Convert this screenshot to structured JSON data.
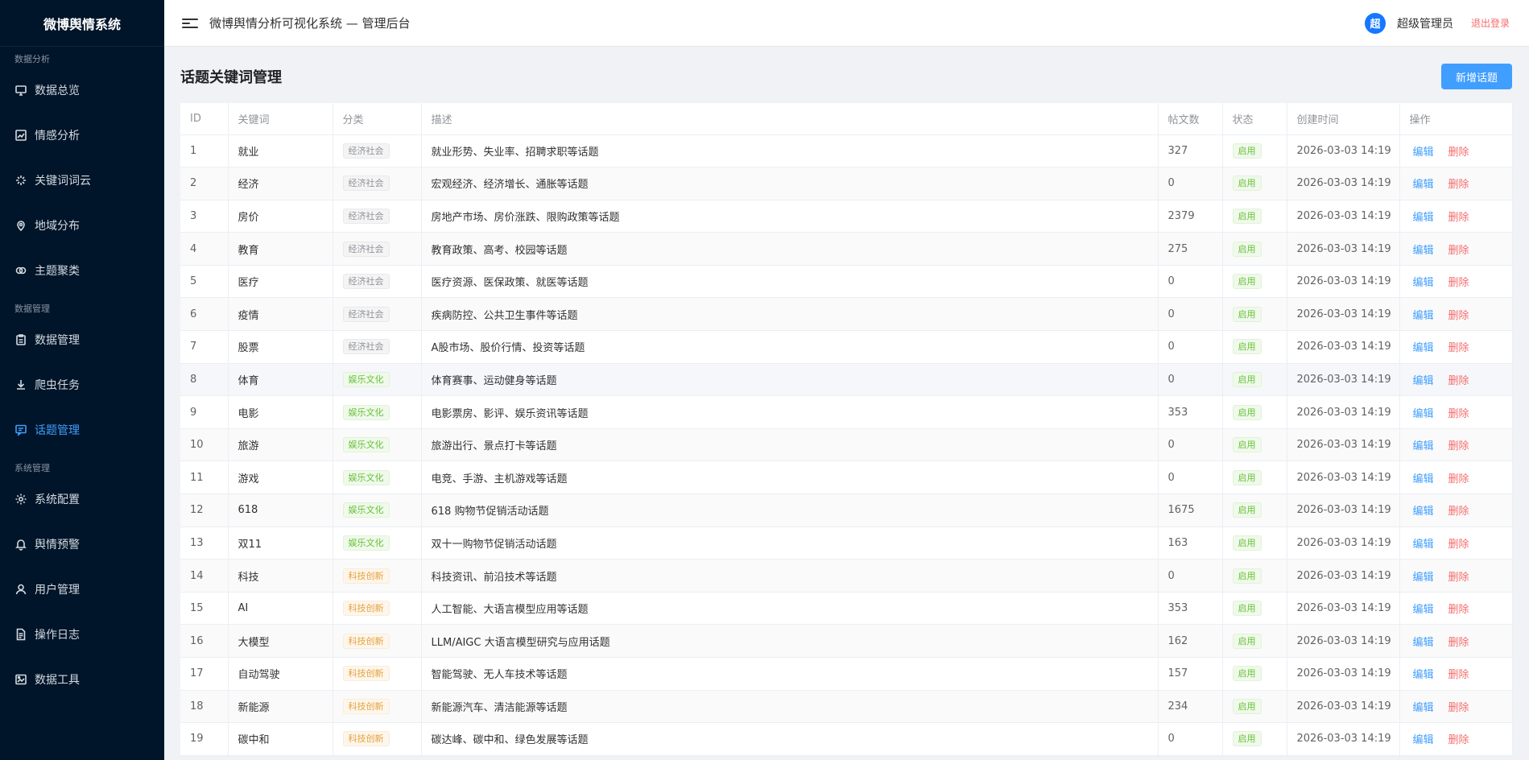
{
  "sidebar": {
    "logo": "微博舆情系统",
    "groups": [
      {
        "title": "数据分析",
        "items": [
          {
            "label": "数据总览",
            "icon": "monitor-icon"
          },
          {
            "label": "情感分析",
            "icon": "line-chart-icon"
          },
          {
            "label": "关键词词云",
            "icon": "sparkle-icon"
          },
          {
            "label": "地域分布",
            "icon": "location-pin-icon"
          },
          {
            "label": "主题聚类",
            "icon": "link-circles-icon"
          }
        ]
      },
      {
        "title": "数据管理",
        "items": [
          {
            "label": "数据管理",
            "icon": "clipboard-icon"
          },
          {
            "label": "爬虫任务",
            "icon": "download-icon"
          },
          {
            "label": "话题管理",
            "icon": "chat-icon",
            "active": true
          }
        ]
      },
      {
        "title": "系统管理",
        "items": [
          {
            "label": "系统配置",
            "icon": "gear-icon"
          },
          {
            "label": "舆情预警",
            "icon": "bell-icon"
          },
          {
            "label": "用户管理",
            "icon": "user-icon"
          },
          {
            "label": "操作日志",
            "icon": "document-icon"
          },
          {
            "label": "数据工具",
            "icon": "image-box-icon"
          }
        ]
      }
    ]
  },
  "header": {
    "title": "微博舆情分析可视化系统 — 管理后台",
    "avatar_text": "超",
    "username": "超级管理员",
    "logout": "退出登录"
  },
  "page": {
    "title": "话题关键词管理",
    "add_button": "新增话题"
  },
  "colors": {
    "accent": "#409eff",
    "danger": "#f56c6c",
    "sidebar_bg": "#001529"
  },
  "table": {
    "columns": [
      "ID",
      "关键词",
      "分类",
      "描述",
      "帖文数",
      "状态",
      "创建时间",
      "操作"
    ],
    "edit_label": "编辑",
    "delete_label": "删除",
    "rows": [
      {
        "id": "1",
        "keyword": "就业",
        "category": "经济社会",
        "cat": "gray",
        "desc": "就业形势、失业率、招聘求职等话题",
        "posts": "327",
        "status": "启用",
        "created": "2026-03-03 14:19"
      },
      {
        "id": "2",
        "keyword": "经济",
        "category": "经济社会",
        "cat": "gray",
        "desc": "宏观经济、经济增长、通胀等话题",
        "posts": "0",
        "status": "启用",
        "created": "2026-03-03 14:19"
      },
      {
        "id": "3",
        "keyword": "房价",
        "category": "经济社会",
        "cat": "gray",
        "desc": "房地产市场、房价涨跌、限购政策等话题",
        "posts": "2379",
        "status": "启用",
        "created": "2026-03-03 14:19"
      },
      {
        "id": "4",
        "keyword": "教育",
        "category": "经济社会",
        "cat": "gray",
        "desc": "教育政策、高考、校园等话题",
        "posts": "275",
        "status": "启用",
        "created": "2026-03-03 14:19"
      },
      {
        "id": "5",
        "keyword": "医疗",
        "category": "经济社会",
        "cat": "gray",
        "desc": "医疗资源、医保政策、就医等话题",
        "posts": "0",
        "status": "启用",
        "created": "2026-03-03 14:19"
      },
      {
        "id": "6",
        "keyword": "疫情",
        "category": "经济社会",
        "cat": "gray",
        "desc": "疾病防控、公共卫生事件等话题",
        "posts": "0",
        "status": "启用",
        "created": "2026-03-03 14:19"
      },
      {
        "id": "7",
        "keyword": "股票",
        "category": "经济社会",
        "cat": "gray",
        "desc": "A股市场、股价行情、投资等话题",
        "posts": "0",
        "status": "启用",
        "created": "2026-03-03 14:19"
      },
      {
        "id": "8",
        "keyword": "体育",
        "category": "娱乐文化",
        "cat": "green",
        "desc": "体育赛事、运动健身等话题",
        "posts": "0",
        "status": "启用",
        "created": "2026-03-03 14:19"
      },
      {
        "id": "9",
        "keyword": "电影",
        "category": "娱乐文化",
        "cat": "green",
        "desc": "电影票房、影评、娱乐资讯等话题",
        "posts": "353",
        "status": "启用",
        "created": "2026-03-03 14:19"
      },
      {
        "id": "10",
        "keyword": "旅游",
        "category": "娱乐文化",
        "cat": "green",
        "desc": "旅游出行、景点打卡等话题",
        "posts": "0",
        "status": "启用",
        "created": "2026-03-03 14:19"
      },
      {
        "id": "11",
        "keyword": "游戏",
        "category": "娱乐文化",
        "cat": "green",
        "desc": "电竞、手游、主机游戏等话题",
        "posts": "0",
        "status": "启用",
        "created": "2026-03-03 14:19"
      },
      {
        "id": "12",
        "keyword": "618",
        "category": "娱乐文化",
        "cat": "green",
        "desc": "618 购物节促销活动话题",
        "posts": "1675",
        "status": "启用",
        "created": "2026-03-03 14:19"
      },
      {
        "id": "13",
        "keyword": "双11",
        "category": "娱乐文化",
        "cat": "green",
        "desc": "双十一购物节促销活动话题",
        "posts": "163",
        "status": "启用",
        "created": "2026-03-03 14:19"
      },
      {
        "id": "14",
        "keyword": "科技",
        "category": "科技创新",
        "cat": "orange",
        "desc": "科技资讯、前沿技术等话题",
        "posts": "0",
        "status": "启用",
        "created": "2026-03-03 14:19"
      },
      {
        "id": "15",
        "keyword": "AI",
        "category": "科技创新",
        "cat": "orange",
        "desc": "人工智能、大语言模型应用等话题",
        "posts": "353",
        "status": "启用",
        "created": "2026-03-03 14:19"
      },
      {
        "id": "16",
        "keyword": "大模型",
        "category": "科技创新",
        "cat": "orange",
        "desc": "LLM/AIGC 大语言模型研究与应用话题",
        "posts": "162",
        "status": "启用",
        "created": "2026-03-03 14:19"
      },
      {
        "id": "17",
        "keyword": "自动驾驶",
        "category": "科技创新",
        "cat": "orange",
        "desc": "智能驾驶、无人车技术等话题",
        "posts": "157",
        "status": "启用",
        "created": "2026-03-03 14:19"
      },
      {
        "id": "18",
        "keyword": "新能源",
        "category": "科技创新",
        "cat": "orange",
        "desc": "新能源汽车、清洁能源等话题",
        "posts": "234",
        "status": "启用",
        "created": "2026-03-03 14:19"
      },
      {
        "id": "19",
        "keyword": "碳中和",
        "category": "科技创新",
        "cat": "orange",
        "desc": "碳达峰、碳中和、绿色发展等话题",
        "posts": "0",
        "status": "启用",
        "created": "2026-03-03 14:19"
      }
    ]
  }
}
